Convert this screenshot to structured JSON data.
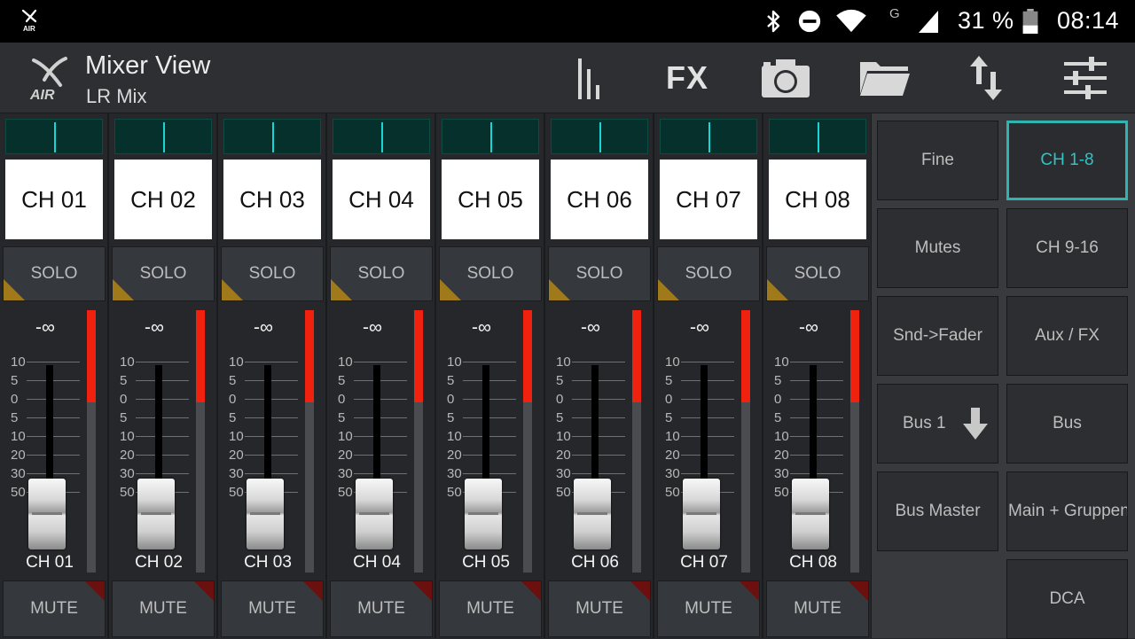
{
  "status_bar": {
    "battery_text": "31 %",
    "time": "08:14",
    "network_label": "G",
    "icons": [
      "xair-app-icon",
      "bluetooth-icon",
      "do-not-disturb-icon",
      "wifi-icon",
      "cell-signal-icon",
      "battery-icon"
    ]
  },
  "app_bar": {
    "title": "Mixer View",
    "subtitle": "LR Mix",
    "fx_label": "FX",
    "tools": [
      "meters-icon",
      "fx-button",
      "camera-icon",
      "folder-icon",
      "sync-arrows-icon",
      "settings-sliders-icon"
    ]
  },
  "channels": [
    {
      "name": "CH 01",
      "solo": "SOLO",
      "mute": "MUTE",
      "fader_value": "-∞",
      "label": "CH 01"
    },
    {
      "name": "CH 02",
      "solo": "SOLO",
      "mute": "MUTE",
      "fader_value": "-∞",
      "label": "CH 02"
    },
    {
      "name": "CH 03",
      "solo": "SOLO",
      "mute": "MUTE",
      "fader_value": "-∞",
      "label": "CH 03"
    },
    {
      "name": "CH 04",
      "solo": "SOLO",
      "mute": "MUTE",
      "fader_value": "-∞",
      "label": "CH 04"
    },
    {
      "name": "CH 05",
      "solo": "SOLO",
      "mute": "MUTE",
      "fader_value": "-∞",
      "label": "CH 05"
    },
    {
      "name": "CH 06",
      "solo": "SOLO",
      "mute": "MUTE",
      "fader_value": "-∞",
      "label": "CH 06"
    },
    {
      "name": "CH 07",
      "solo": "SOLO",
      "mute": "MUTE",
      "fader_value": "-∞",
      "label": "CH 07"
    },
    {
      "name": "CH 08",
      "solo": "SOLO",
      "mute": "MUTE",
      "fader_value": "-∞",
      "label": "CH 08"
    }
  ],
  "fader_scale": [
    "10",
    "5",
    "0",
    "5",
    "10",
    "20",
    "30",
    "50"
  ],
  "colors": {
    "accent": "#2fb4b0",
    "peak_meter": "#f0210f",
    "solo_indicator": "#a07a1a",
    "mute_indicator": "#6b0f0f",
    "pan_line": "#1ad5d5"
  },
  "panel": {
    "left": [
      "Fine",
      "Mutes",
      "Snd->Fader",
      "Bus 1",
      "Bus Master"
    ],
    "right": [
      "CH 1-8",
      "CH 9-16",
      "Aux / FX",
      "Bus",
      "Main + Gruppen",
      "DCA"
    ],
    "active": "CH 1-8"
  }
}
